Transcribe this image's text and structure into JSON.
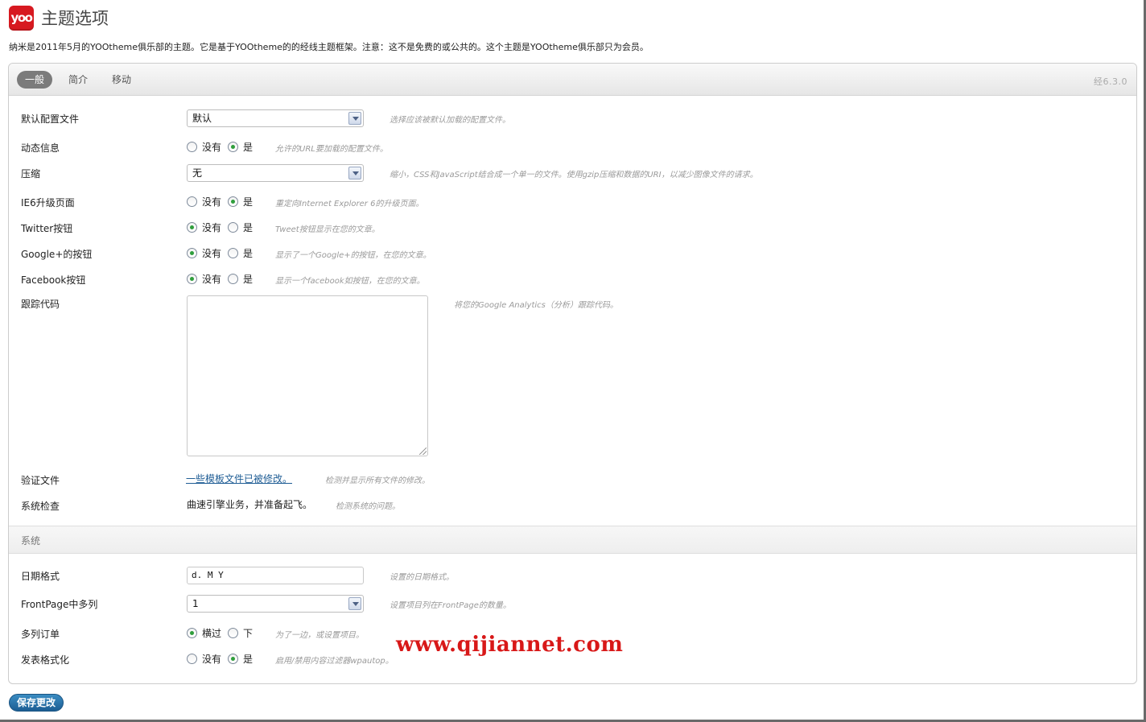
{
  "header": {
    "logo_text": "yoo",
    "title": "主题选项",
    "intro": "纳米是2011年5月的YOOtheme俱乐部的主题。它是基于YOOtheme的的经线主题框架。注意：这不是免费的或公共的。这个主题是YOOtheme俱乐部只为会员。"
  },
  "tabs": [
    {
      "label": "一般",
      "active": true
    },
    {
      "label": "简介",
      "active": false
    },
    {
      "label": "移动",
      "active": false
    }
  ],
  "version": "经6.3.0",
  "general": {
    "default_profile": {
      "label": "默认配置文件",
      "value": "默认",
      "hint": "选择应该被默认加载的配置文件。"
    },
    "dynamic_info": {
      "label": "动态信息",
      "options": [
        "没有",
        "是"
      ],
      "selected": 1,
      "hint": "允许的URL要加载的配置文件。"
    },
    "compression": {
      "label": "压缩",
      "value": "无",
      "hint": "缩小，CSS和JavaScript结合成一个单一的文件。使用gzip压缩和数据的URI，以减少图像文件的请求。"
    },
    "ie6_upgrade": {
      "label": "IE6升级页面",
      "options": [
        "没有",
        "是"
      ],
      "selected": 1,
      "hint": "重定向Internet Explorer 6的升级页面。"
    },
    "twitter": {
      "label": "Twitter按钮",
      "options": [
        "没有",
        "是"
      ],
      "selected": 0,
      "hint": "Tweet按钮显示在您的文章。"
    },
    "googleplus": {
      "label": "Google+的按钮",
      "options": [
        "没有",
        "是"
      ],
      "selected": 0,
      "hint": "显示了一个Google+的按钮，在您的文章。"
    },
    "facebook": {
      "label": "Facebook按钮",
      "options": [
        "没有",
        "是"
      ],
      "selected": 0,
      "hint": "显示一个facebook如按钮，在您的文章。"
    },
    "tracking": {
      "label": "跟踪代码",
      "value": "",
      "hint": "将您的Google Analytics（分析）跟踪代码。"
    },
    "verify": {
      "label": "验证文件",
      "link": "一些模板文件已被修改。",
      "hint": "检测并显示所有文件的修改。"
    },
    "syscheck": {
      "label": "系统检查",
      "value": "曲速引擎业务，并准备起飞。",
      "hint": "检测系统的问题。"
    }
  },
  "system": {
    "section_title": "系统",
    "date_format": {
      "label": "日期格式",
      "value": "d. M Y",
      "hint": "设置的日期格式。"
    },
    "frontpage_columns": {
      "label": "FrontPage中多列",
      "value": "1",
      "hint": "设置项目列在FrontPage的数量。"
    },
    "column_order": {
      "label": "多列订单",
      "options": [
        "横过",
        "下"
      ],
      "selected": 0,
      "hint": "为了一边，或设置项目。"
    },
    "post_format": {
      "label": "发表格式化",
      "options": [
        "没有",
        "是"
      ],
      "selected": 1,
      "hint": "启用/禁用内容过滤器wpautop。"
    }
  },
  "watermark": "www.qijiannet.com",
  "save_label": "保存更改",
  "colors": {
    "brand": "#d71920",
    "active_tab": "#7b7b7b",
    "save_button": "#1c5d93",
    "radio_on": "#2f9e3c",
    "watermark": "#d81818"
  }
}
